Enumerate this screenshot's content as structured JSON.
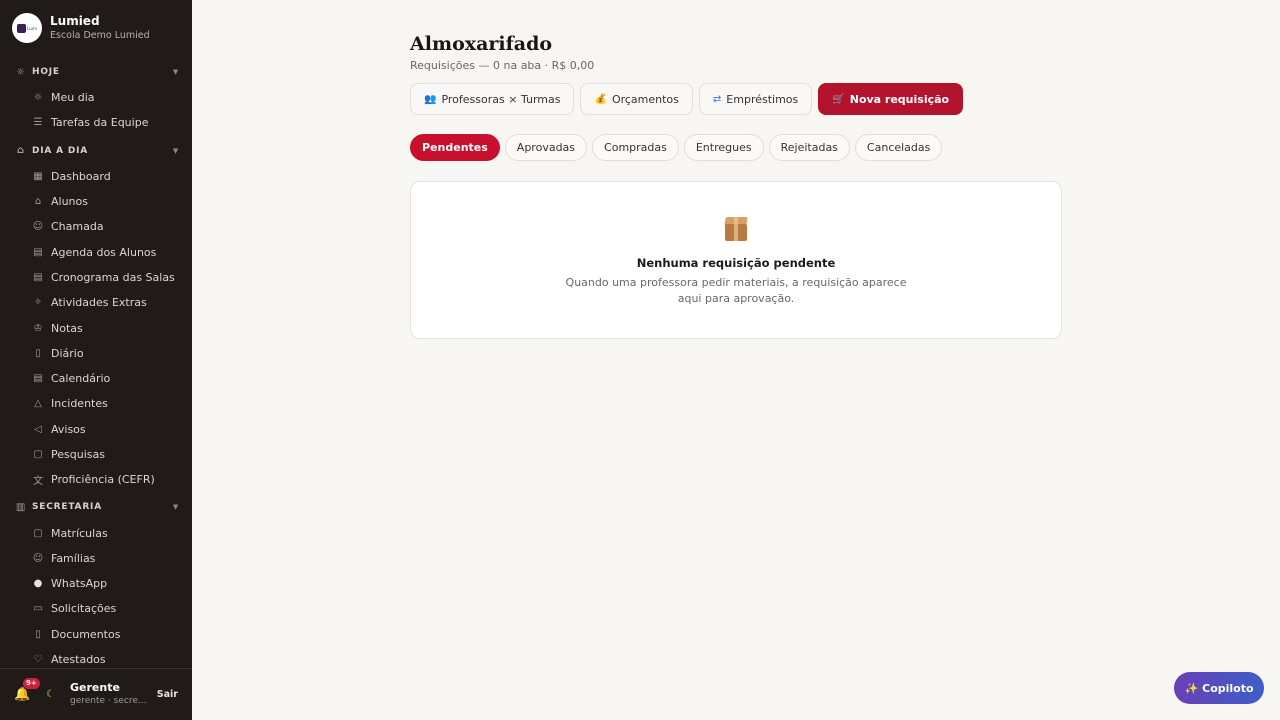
{
  "brand": {
    "name": "Lumied",
    "subtitle": "Escola Demo Lumied",
    "logo_text": "Lumi"
  },
  "sidebar": {
    "sections": [
      {
        "label": "HOJE",
        "icon": "sun-icon",
        "items": [
          {
            "label": "Meu dia",
            "icon": "sun-icon"
          },
          {
            "label": "Tarefas da Equipe",
            "icon": "list-check-icon"
          }
        ]
      },
      {
        "label": "DIA A DIA",
        "icon": "graduation-cap-icon",
        "items": [
          {
            "label": "Dashboard",
            "icon": "grid-icon"
          },
          {
            "label": "Alunos",
            "icon": "graduation-cap-icon"
          },
          {
            "label": "Chamada",
            "icon": "user-check-icon"
          },
          {
            "label": "Agenda dos Alunos",
            "icon": "calendar-icon"
          },
          {
            "label": "Cronograma das Salas",
            "icon": "calendar-icon"
          },
          {
            "label": "Atividades Extras",
            "icon": "sparkles-icon"
          },
          {
            "label": "Notas",
            "icon": "award-icon"
          },
          {
            "label": "Diário",
            "icon": "book-icon"
          },
          {
            "label": "Calendário",
            "icon": "calendar-icon"
          },
          {
            "label": "Incidentes",
            "icon": "warning-icon"
          },
          {
            "label": "Avisos",
            "icon": "megaphone-icon"
          },
          {
            "label": "Pesquisas",
            "icon": "clipboard-icon"
          },
          {
            "label": "Proficiência (CEFR)",
            "icon": "translate-icon"
          }
        ]
      },
      {
        "label": "SECRETARIA",
        "icon": "building-icon",
        "items": [
          {
            "label": "Matrículas",
            "icon": "clipboard-icon"
          },
          {
            "label": "Famílias",
            "icon": "users-icon"
          },
          {
            "label": "WhatsApp",
            "icon": "chat-icon"
          },
          {
            "label": "Solicitações",
            "icon": "message-icon"
          },
          {
            "label": "Documentos",
            "icon": "document-icon"
          },
          {
            "label": "Atestados",
            "icon": "stethoscope-icon"
          }
        ]
      }
    ]
  },
  "user": {
    "name": "Gerente",
    "role": "gerente · secre...",
    "logout_label": "Sair",
    "notification_badge": "9+"
  },
  "header": {
    "title": "Almoxarifado",
    "subtitle": "Requisições — 0 na aba · R$ 0,00"
  },
  "actions": [
    {
      "label": "Professoras × Turmas",
      "icon": "people-icon",
      "primary": false
    },
    {
      "label": "Orçamentos",
      "icon": "money-bag-icon",
      "primary": false
    },
    {
      "label": "Empréstimos",
      "icon": "repeat-icon",
      "primary": false
    },
    {
      "label": "Nova requisição",
      "icon": "cart-icon",
      "primary": true
    }
  ],
  "tabs": [
    {
      "label": "Pendentes",
      "active": true
    },
    {
      "label": "Aprovadas",
      "active": false
    },
    {
      "label": "Compradas",
      "active": false
    },
    {
      "label": "Entregues",
      "active": false
    },
    {
      "label": "Rejeitadas",
      "active": false
    },
    {
      "label": "Canceladas",
      "active": false
    }
  ],
  "empty_state": {
    "icon": "package-icon",
    "title": "Nenhuma requisição pendente",
    "description": "Quando uma professora pedir materiais, a requisição aparece aqui para aprovação."
  },
  "copilot": {
    "label": "Copiloto",
    "icon": "sparkle-icon"
  },
  "colors": {
    "sidebar_bg": "#201b18",
    "accent": "#c8102e",
    "page_bg": "#f7f6f3"
  }
}
